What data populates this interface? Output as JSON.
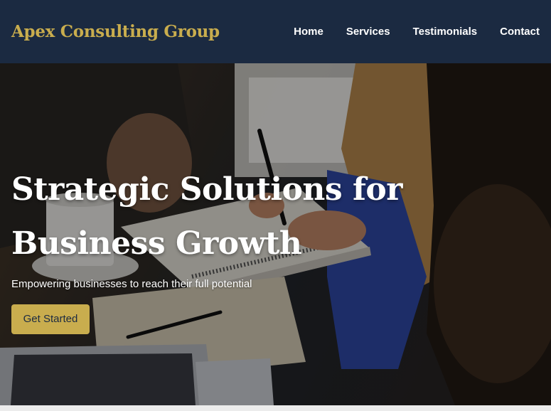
{
  "header": {
    "brand": "Apex Consulting Group",
    "nav": [
      {
        "label": "Home"
      },
      {
        "label": "Services"
      },
      {
        "label": "Testimonials"
      },
      {
        "label": "Contact"
      }
    ]
  },
  "hero": {
    "title": "Strategic Solutions for Business Growth",
    "subtitle": "Empowering businesses to reach their full potential",
    "cta_label": "Get Started"
  },
  "colors": {
    "navbar_bg": "#1b2a41",
    "brand_gold": "#c9ad4e",
    "text_white": "#ffffff"
  }
}
